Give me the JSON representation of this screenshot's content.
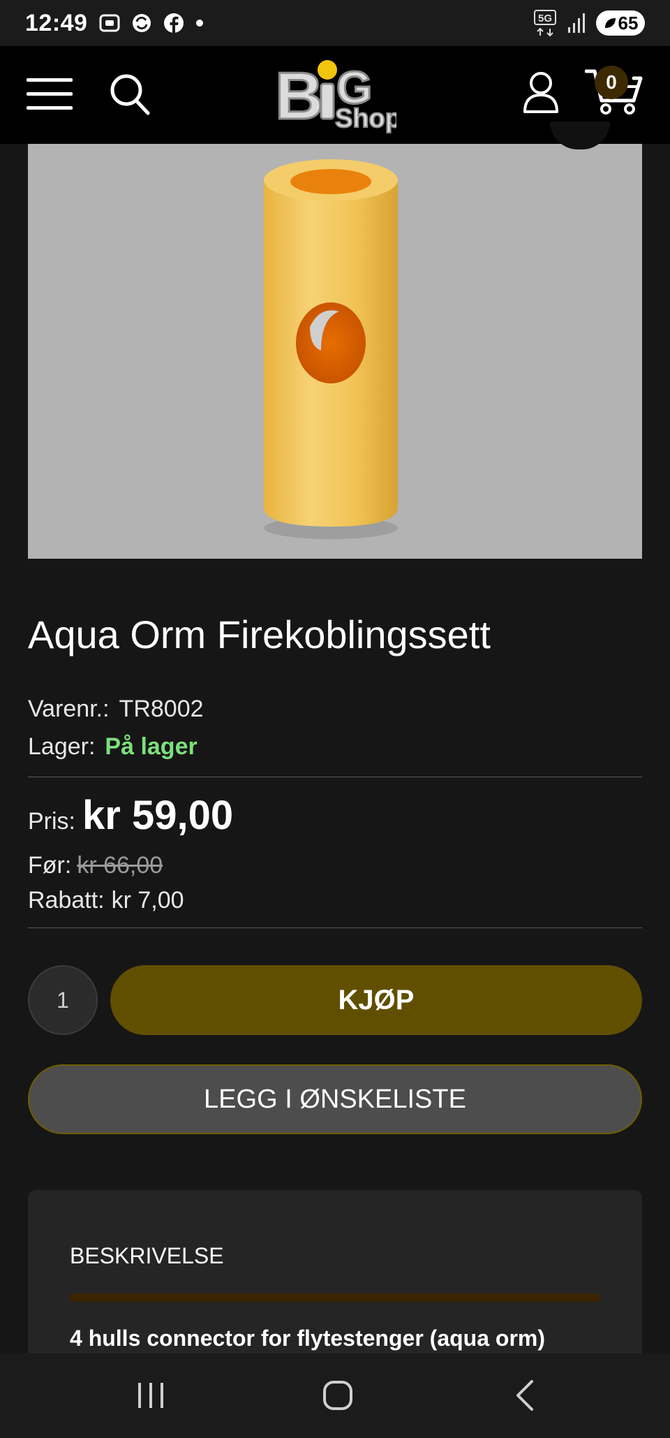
{
  "status_bar": {
    "time": "12:49",
    "network": "5G",
    "battery": "65"
  },
  "header": {
    "logo": "BIG Shop",
    "cart_count": "0",
    "icons": [
      "menu-icon",
      "search-icon",
      "user-icon",
      "cart-icon"
    ]
  },
  "product": {
    "title": "Aqua Orm Firekoblingssett",
    "sku_label": "Varenr.:",
    "sku": "TR8002",
    "stock_label": "Lager:",
    "stock": "På lager",
    "price_label": "Pris:",
    "price": "kr 59,00",
    "before_label": "Før:",
    "before_price": "kr 66,00",
    "discount_label": "Rabatt:",
    "discount": "kr 7,00",
    "quantity": "1",
    "buy_label": "KJØP",
    "wishlist_label": "LEGG I ØNSKELISTE"
  },
  "description": {
    "title": "BESKRIVELSE",
    "text": "4 hulls connector for flytestenger (aqua orm)"
  },
  "colors": {
    "background": "#161616",
    "buy_button": "#614f00",
    "in_stock": "#7ce07c",
    "wishlist_button": "#4d4d4d"
  }
}
